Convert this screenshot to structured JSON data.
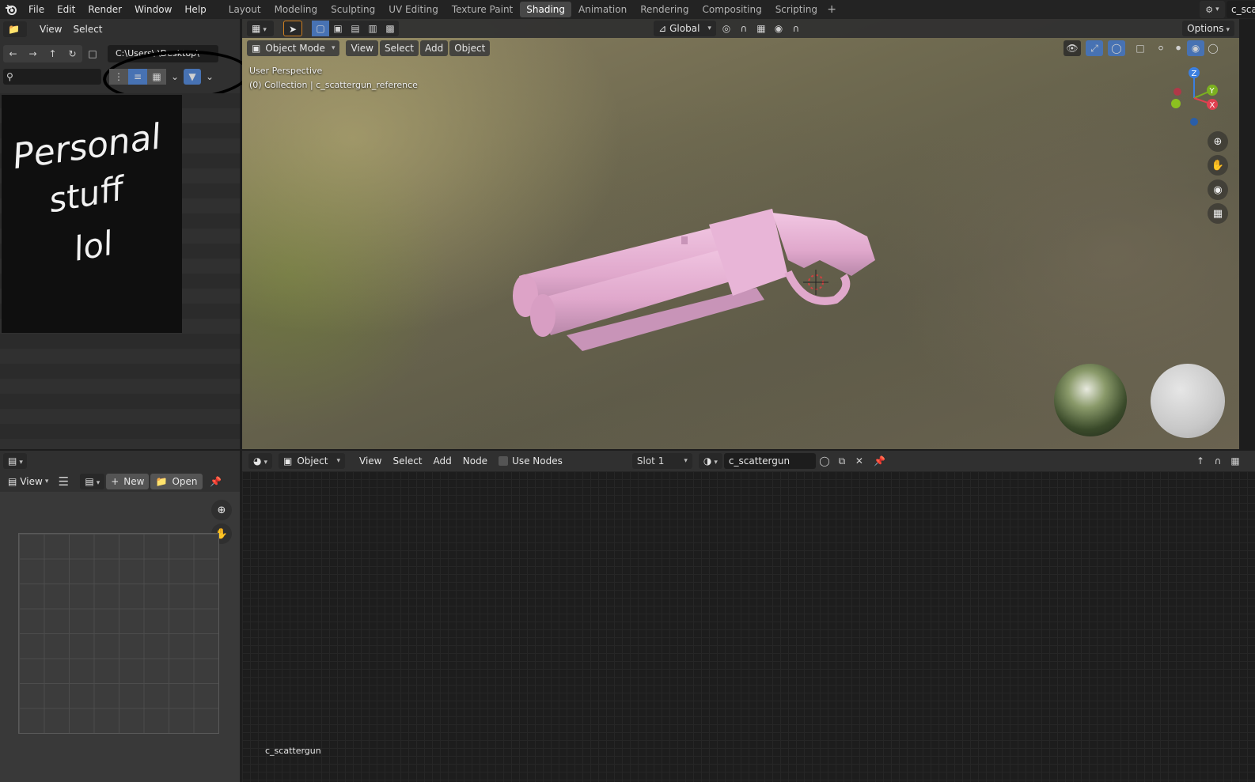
{
  "menu": {
    "items": [
      "File",
      "Edit",
      "Render",
      "Window",
      "Help"
    ]
  },
  "workspaces": {
    "tabs": [
      "Layout",
      "Modeling",
      "Sculpting",
      "UV Editing",
      "Texture Paint",
      "Shading",
      "Animation",
      "Rendering",
      "Compositing",
      "Scripting"
    ],
    "active": "Shading",
    "add_label": "+"
  },
  "scene": {
    "name": "c_sca"
  },
  "file_browser": {
    "menu_view": "View",
    "menu_select": "Select",
    "path": "C:\\Users\\       \\Desktop\\",
    "search_placeholder": "",
    "thumbnail_text": [
      "Personal",
      "stuff",
      "lol"
    ]
  },
  "viewport": {
    "transform_orientation": "Global",
    "options_label": "Options",
    "mode": "Object Mode",
    "menus": [
      "View",
      "Select",
      "Add",
      "Object"
    ],
    "perspective_label": "User Perspective",
    "collection_label": "(0) Collection | c_scattergun_reference",
    "gizmo_axes": {
      "x": "X",
      "y": "Y",
      "z": "Z"
    }
  },
  "image_editor": {
    "view_label": "View",
    "new_label": "New",
    "open_label": "Open"
  },
  "node_editor": {
    "object_type": "Object",
    "menus": [
      "View",
      "Select",
      "Add",
      "Node"
    ],
    "use_nodes_label": "Use Nodes",
    "slot": "Slot 1",
    "material_name": "c_scattergun",
    "material_label": "c_scattergun"
  },
  "colors": {
    "accent_blue": "#4772b3",
    "active_tab": "#474747",
    "model_pink": "#e3aed0",
    "annotation": "#000000"
  }
}
